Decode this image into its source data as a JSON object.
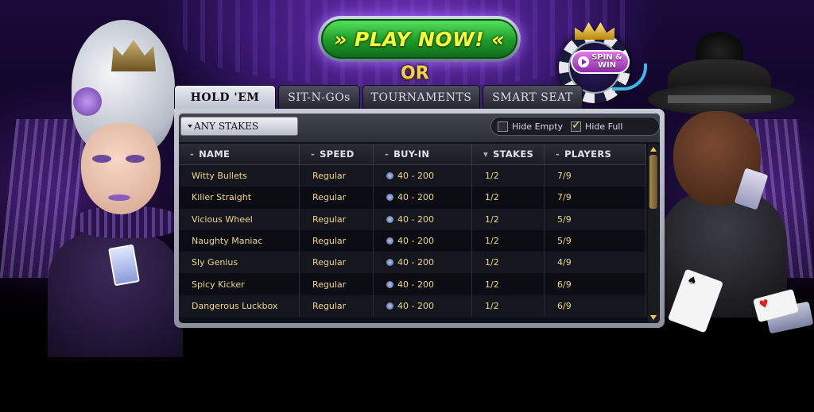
{
  "header": {
    "play_now": "» PLAY NOW! «",
    "or": "OR",
    "spin_win": "SPIN & WIN"
  },
  "tabs": [
    {
      "label": "HOLD 'EM",
      "active": true
    },
    {
      "label": "SIT-N-GOs",
      "active": false
    },
    {
      "label": "TOURNAMENTS",
      "active": false
    },
    {
      "label": "SMART SEAT",
      "active": false
    }
  ],
  "toolbar": {
    "stakes_label": "ANY STAKES",
    "filters": [
      {
        "label": "Hide Empty",
        "checked": false
      },
      {
        "label": "Hide Full",
        "checked": true
      }
    ]
  },
  "table": {
    "columns": [
      "NAME",
      "SPEED",
      "BUY-IN",
      "STAKES",
      "PLAYERS"
    ],
    "rows": [
      {
        "name": "Witty Bullets",
        "speed": "Regular",
        "buyin": "40 - 200",
        "stakes": "1/2",
        "players": "7/9"
      },
      {
        "name": "Killer Straight",
        "speed": "Regular",
        "buyin": "40 - 200",
        "stakes": "1/2",
        "players": "7/9"
      },
      {
        "name": "Vicious Wheel",
        "speed": "Regular",
        "buyin": "40 - 200",
        "stakes": "1/2",
        "players": "5/9"
      },
      {
        "name": "Naughty Maniac",
        "speed": "Regular",
        "buyin": "40 - 200",
        "stakes": "1/2",
        "players": "5/9"
      },
      {
        "name": "Sly Genius",
        "speed": "Regular",
        "buyin": "40 - 200",
        "stakes": "1/2",
        "players": "4/9"
      },
      {
        "name": "Spicy Kicker",
        "speed": "Regular",
        "buyin": "40 - 200",
        "stakes": "1/2",
        "players": "6/9"
      },
      {
        "name": "Dangerous Luckbox",
        "speed": "Regular",
        "buyin": "40 - 200",
        "stakes": "1/2",
        "players": "6/9"
      }
    ]
  },
  "icons": {
    "play_button": "green-pill-button",
    "spin_chip": "poker-chip-icon",
    "buyin_chip": "chip-icon",
    "sort_marker": "dash-marker"
  },
  "colors": {
    "play_green": "#1e9c2a",
    "play_text": "#f5ff3a",
    "row_text": "#f0d58c",
    "background_purple": "#3e1a78"
  }
}
